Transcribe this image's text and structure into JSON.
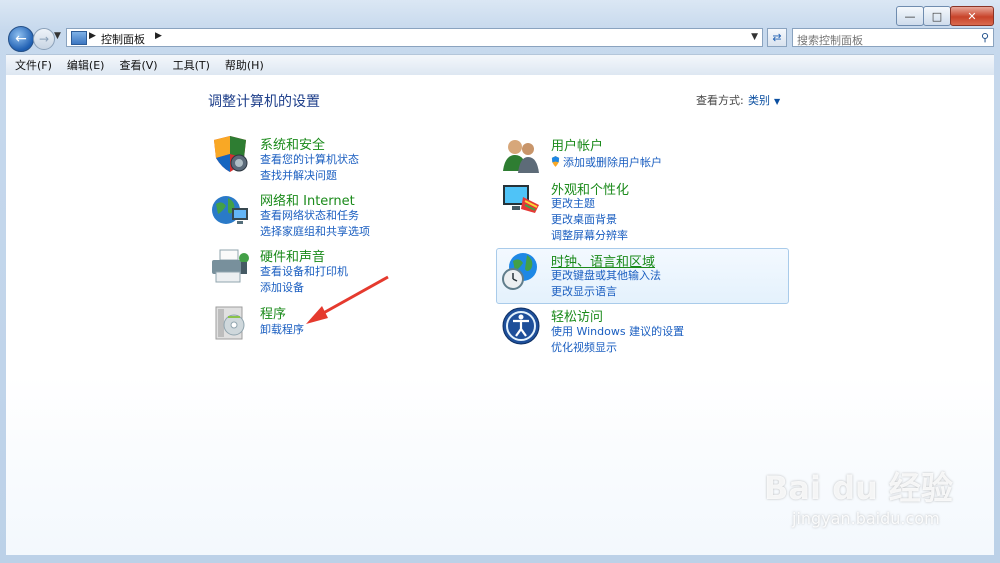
{
  "nav": {
    "breadcrumb": "控制面板",
    "search_placeholder": "搜索控制面板"
  },
  "menu": [
    "文件(F)",
    "编辑(E)",
    "查看(V)",
    "工具(T)",
    "帮助(H)"
  ],
  "page_title": "调整计算机的设置",
  "view_by": {
    "label": "查看方式:",
    "value": "类别"
  },
  "categories_left": [
    {
      "title": "系统和安全",
      "links": [
        "查看您的计算机状态",
        "查找并解决问题"
      ]
    },
    {
      "title": "网络和 Internet",
      "links": [
        "查看网络状态和任务",
        "选择家庭组和共享选项"
      ]
    },
    {
      "title": "硬件和声音",
      "links": [
        "查看设备和打印机",
        "添加设备"
      ]
    },
    {
      "title": "程序",
      "links": [
        "卸载程序"
      ]
    }
  ],
  "categories_right": [
    {
      "title": "用户帐户",
      "links": [
        "添加或删除用户帐户"
      ]
    },
    {
      "title": "外观和个性化",
      "links": [
        "更改主题",
        "更改桌面背景",
        "调整屏幕分辨率"
      ]
    },
    {
      "title": "时钟、语言和区域",
      "links": [
        "更改键盘或其他输入法",
        "更改显示语言"
      ]
    },
    {
      "title": "轻松访问",
      "links": [
        "使用 Windows 建议的设置",
        "优化视频显示"
      ]
    }
  ],
  "watermark": {
    "brand": "Bai du 经验",
    "url": "jingyan.baidu.com"
  },
  "colors": {
    "link": "#1a5ec0",
    "heading": "#1a8a1a",
    "title": "#1e3f8a",
    "annotation_arrow": "#e53a2e"
  }
}
